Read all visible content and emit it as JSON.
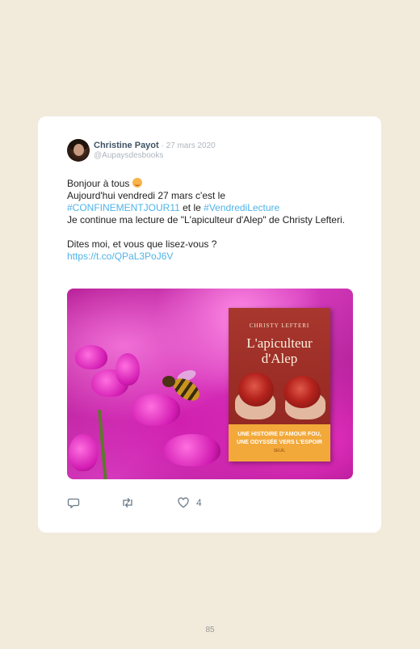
{
  "tweet": {
    "author_name": "Christine Payot",
    "date": " · 27 mars 2020",
    "handle": "@Aupaysdesbooks",
    "line1": "Bonjour à tous",
    "line2_pre": "Aujourd'hui vendredi 27 mars c'est le",
    "hashtag1": "#CONFINEMENTJOUR11",
    "line3_mid": " et le ",
    "hashtag2": "#VendrediLecture",
    "line4": "Je continue ma lecture de \"L'apiculteur d'Alep\" de Christy Lefteri.",
    "line5": "Dites moi, et vous que lisez-vous ?",
    "link": "https://t.co/QPaL3PoJ6V"
  },
  "book_cover": {
    "author": "CHRISTY LEFTERI",
    "title_line1": "L'apiculteur",
    "title_line2": "d'Alep",
    "band_line1": "UNE HISTOIRE D'AMOUR FOU,",
    "band_line2": "UNE ODYSSÉE VERS L'ESPOIR",
    "publisher": "SEUIL"
  },
  "actions": {
    "reply_icon": "reply-icon",
    "retweet_icon": "retweet-icon",
    "like_icon": "heart-icon",
    "like_count": "4"
  },
  "page_number": "85",
  "colors": {
    "background": "#f2eadb",
    "link": "#4fb3e8",
    "author": "#3e5366"
  }
}
